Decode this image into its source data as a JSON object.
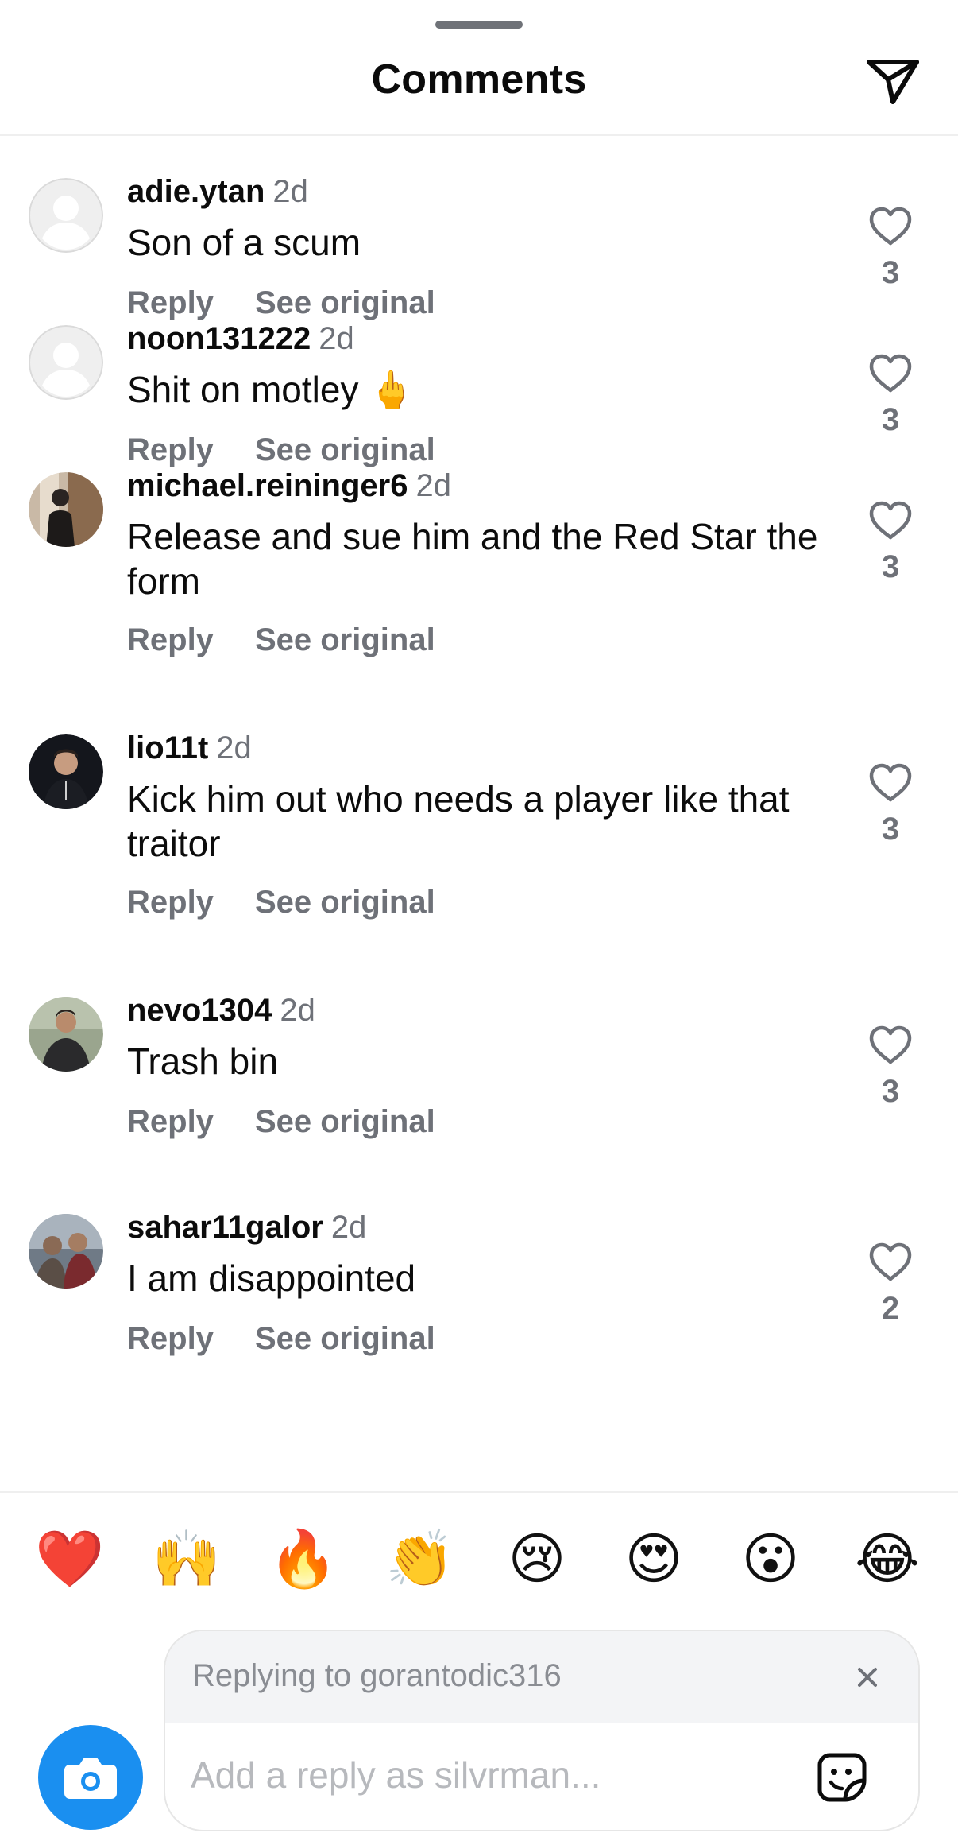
{
  "header": {
    "title": "Comments",
    "share_icon": "paper-plane-icon"
  },
  "comments": [
    {
      "username": "adie.ytan",
      "time": "2d",
      "text": "Son of a scum",
      "reply_label": "Reply",
      "see_original_label": "See original",
      "likes": "3",
      "avatar": "default-avatar"
    },
    {
      "username": "noon131222",
      "time": "2d",
      "text": "Shit on motley 🖕",
      "reply_label": "Reply",
      "see_original_label": "See original",
      "likes": "3",
      "avatar": "default-avatar"
    },
    {
      "username": "michael.reininger6",
      "time": "2d",
      "text": "Release and sue him and the Red Star the form",
      "reply_label": "Reply",
      "see_original_label": "See original",
      "likes": "3",
      "avatar": "photo-avatar"
    },
    {
      "username": "lio11t",
      "time": "2d",
      "text": "Kick him out who needs a player like that traitor",
      "reply_label": "Reply",
      "see_original_label": "See original",
      "likes": "3",
      "avatar": "photo-avatar"
    },
    {
      "username": "nevo1304",
      "time": "2d",
      "text": "Trash bin",
      "reply_label": "Reply",
      "see_original_label": "See original",
      "likes": "3",
      "avatar": "photo-avatar"
    },
    {
      "username": "sahar11galor",
      "time": "2d",
      "text": "I am disappointed",
      "reply_label": "Reply",
      "see_original_label": "See original",
      "likes": "2",
      "avatar": "photo-avatar"
    }
  ],
  "emoji_bar": [
    "❤️",
    "🙌",
    "🔥",
    "👏",
    "😢",
    "😍",
    "😮",
    "😂"
  ],
  "composer": {
    "replying_to": "Replying to gorantodic316",
    "placeholder": "Add a reply as silvrman..."
  },
  "colors": {
    "accent_blue": "#1a8ff0",
    "secondary_text": "#6e7178",
    "primary_text": "#0c0c0c"
  }
}
